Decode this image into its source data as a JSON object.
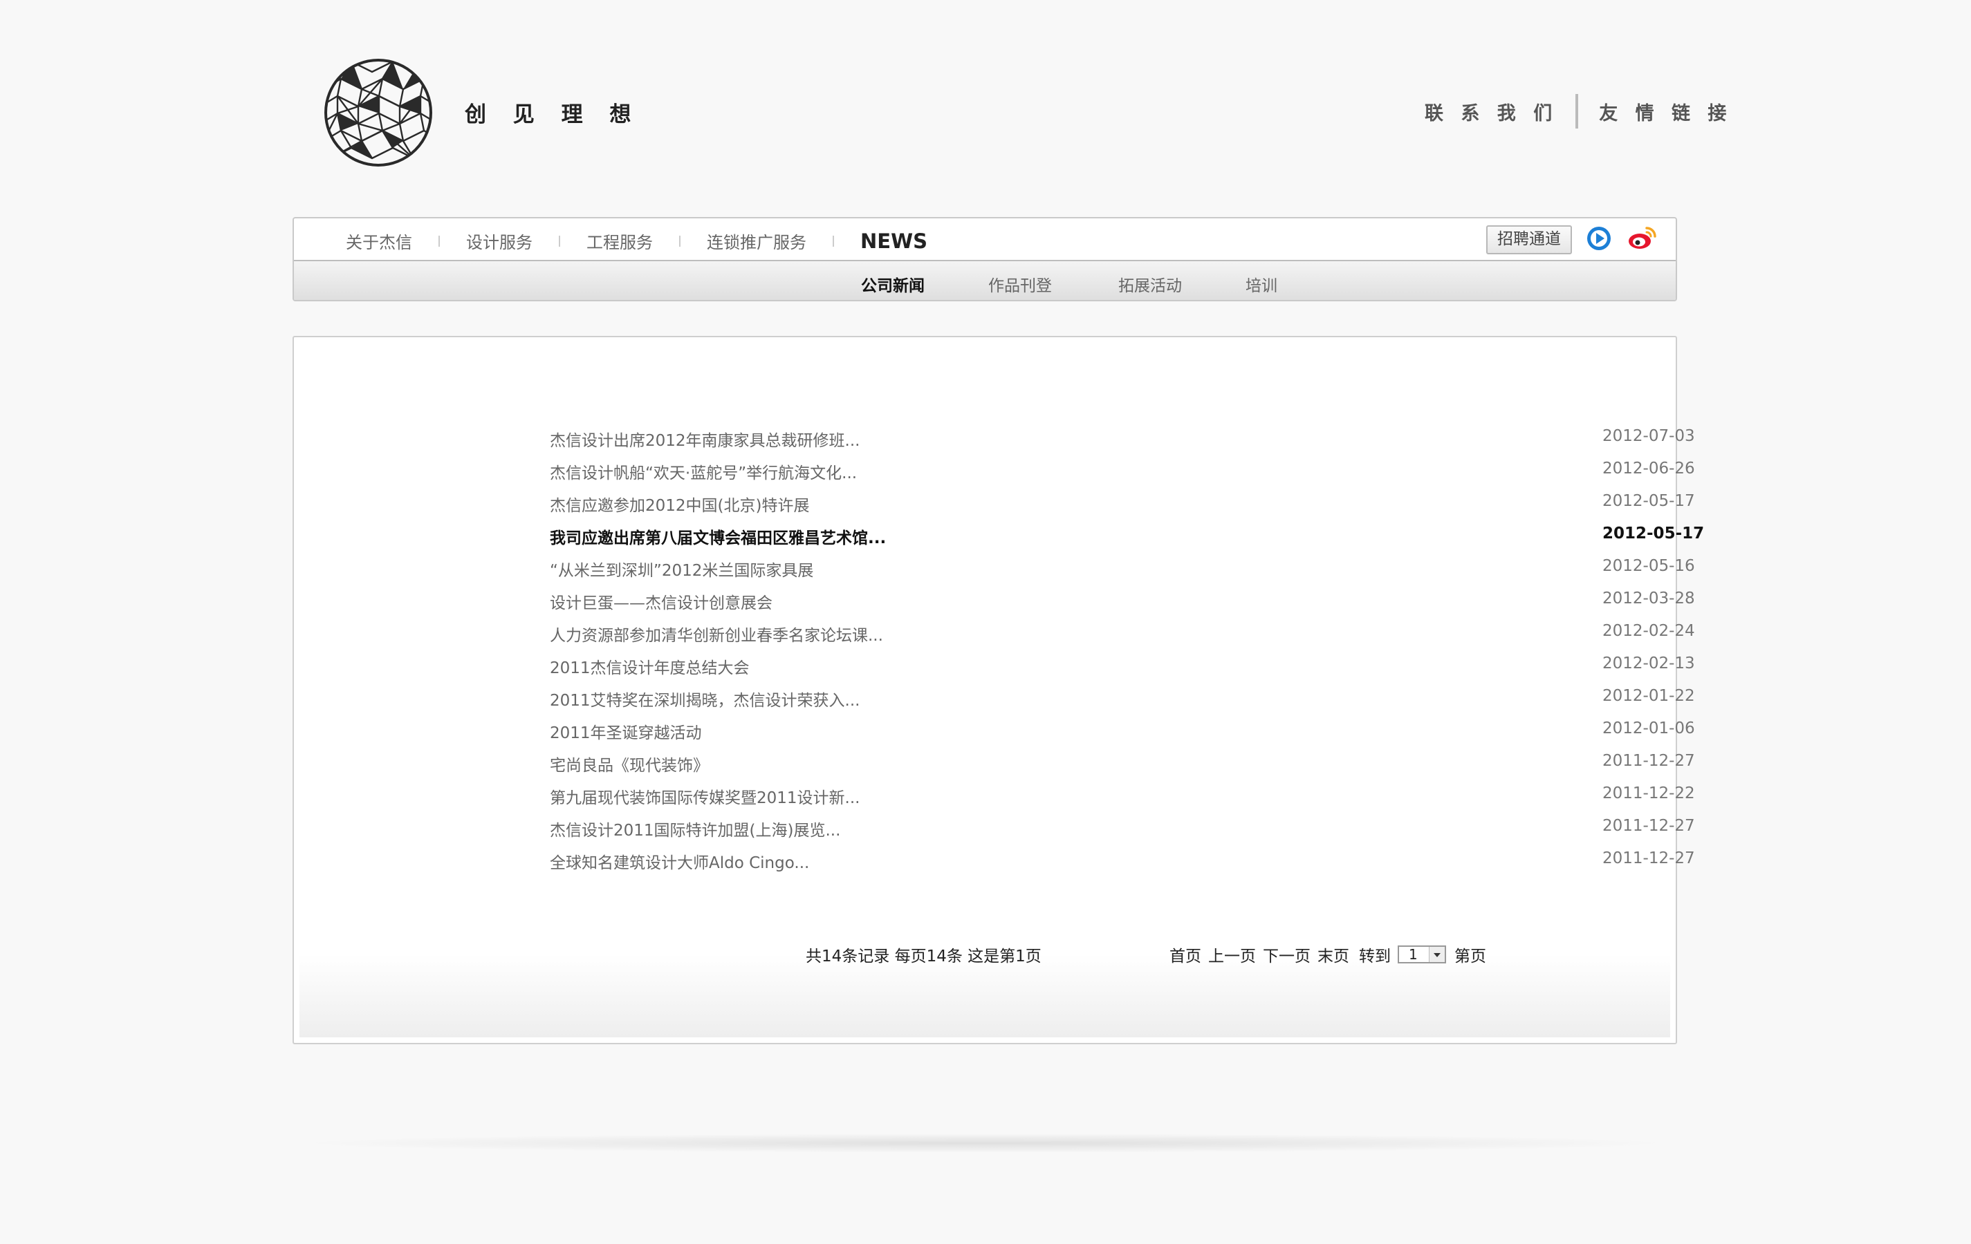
{
  "header": {
    "slogan": "创 见 理 想",
    "links": [
      {
        "label": "联 系 我 们"
      },
      {
        "label": "友 情 链 接"
      }
    ]
  },
  "nav": {
    "main": [
      {
        "label": "关于杰信"
      },
      {
        "label": "设计服务"
      },
      {
        "label": "工程服务"
      },
      {
        "label": "连锁推广服务"
      },
      {
        "label": "NEWS"
      }
    ],
    "recruit_label": "招聘通道",
    "sub": [
      {
        "label": "公司新闻"
      },
      {
        "label": "作品刊登"
      },
      {
        "label": "拓展活动"
      },
      {
        "label": "培训"
      }
    ]
  },
  "news": [
    {
      "title": "杰信设计出席2012年南康家具总裁研修班...",
      "date": "2012-07-03"
    },
    {
      "title": "杰信设计帆船“欢天·蓝舵号”举行航海文化...",
      "date": "2012-06-26"
    },
    {
      "title": "杰信应邀参加2012中国(北京)特许展",
      "date": "2012-05-17"
    },
    {
      "title": "我司应邀出席第八届文博会福田区雅昌艺术馆...",
      "date": "2012-05-17",
      "bold": true
    },
    {
      "title": "“从米兰到深圳”2012米兰国际家具展",
      "date": "2012-05-16"
    },
    {
      "title": "设计巨蛋——杰信设计创意展会",
      "date": "2012-03-28"
    },
    {
      "title": "人力资源部参加清华创新创业春季名家论坛课...",
      "date": "2012-02-24"
    },
    {
      "title": "2011杰信设计年度总结大会",
      "date": "2012-02-13"
    },
    {
      "title": "2011艾特奖在深圳揭晓，杰信设计荣获入...",
      "date": "2012-01-22"
    },
    {
      "title": "2011年圣诞穿越活动",
      "date": "2012-01-06"
    },
    {
      "title": "宅尚良品《现代装饰》",
      "date": "2011-12-27"
    },
    {
      "title": "第九届现代装饰国际传媒奖暨2011设计新...",
      "date": "2011-12-22"
    },
    {
      "title": "杰信设计2011国际特许加盟(上海)展览...",
      "date": "2011-12-27"
    },
    {
      "title": "全球知名建筑设计大师Aldo Cingo...",
      "date": "2011-12-27"
    }
  ],
  "pagination": {
    "info": "共14条记录 每页14条 这是第1页",
    "first": "首页",
    "prev": "上一页",
    "next": "下一页",
    "last": "末页",
    "goto": "转到",
    "selected": "1",
    "page_suffix": "第页"
  },
  "icons": {
    "logo": "geodesic-sphere-logo",
    "video": "video-play-icon",
    "weibo": "weibo-icon"
  },
  "colors": {
    "background": "#f8f8f8",
    "video_blue": "#1d7fd6",
    "weibo_red": "#e6162d",
    "weibo_orange": "#f5a623"
  }
}
